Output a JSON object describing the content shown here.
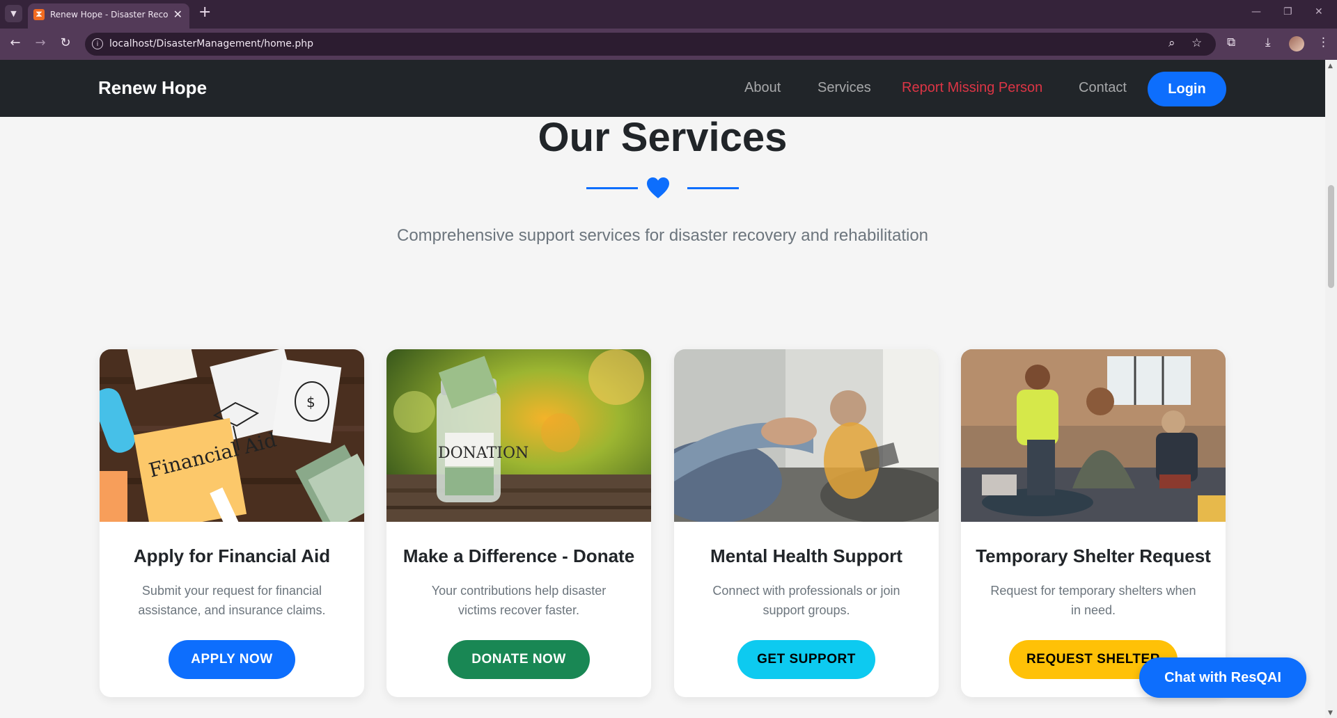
{
  "browser": {
    "tab_title": "Renew Hope - Disaster Recovery",
    "tab_favicon": "XAMPP",
    "url": "localhost/DisasterManagement/home.php",
    "new_tab_symbol": "+",
    "close_tab_symbol": "✕"
  },
  "site": {
    "brand": "Renew Hope",
    "nav": {
      "about": "About",
      "services": "Services",
      "report": "Report Missing Person",
      "contact": "Contact",
      "login": "Login"
    }
  },
  "section": {
    "title": "Our Services",
    "subtitle": "Comprehensive support services for disaster recovery and rehabilitation"
  },
  "cards": [
    {
      "title": "Apply for Financial Aid",
      "text": "Submit your request for financial assistance, and insurance claims.",
      "button": "APPLY NOW",
      "image_label": "Financial Aid",
      "button_color": "#0d6efd"
    },
    {
      "title": "Make a Difference - Donate",
      "text": "Your contributions help disaster victims recover faster.",
      "button": "DONATE NOW",
      "image_label": "DONATION",
      "button_color": "#198754"
    },
    {
      "title": "Mental Health Support",
      "text": "Connect with professionals or join support groups.",
      "button": "GET SUPPORT",
      "button_color": "#0dcaf0"
    },
    {
      "title": "Temporary Shelter Request",
      "text": "Request for temporary shelters when in need.",
      "button": "REQUEST SHELTER",
      "button_color": "#ffc107"
    }
  ],
  "chat": {
    "label": "Chat with ResQAI"
  },
  "colors": {
    "primary": "#0d6efd",
    "danger": "#dc3545",
    "navbar": "#212529",
    "browser_frame": "#533a58"
  },
  "icons": {
    "tab_search": "chevron-down-icon",
    "reload": "reload-icon",
    "zoom": "zoom-icon",
    "bookmark": "star-icon",
    "extensions": "puzzle-icon",
    "download": "download-icon",
    "menu": "kebab-menu-icon",
    "divider": "heart-icon"
  }
}
